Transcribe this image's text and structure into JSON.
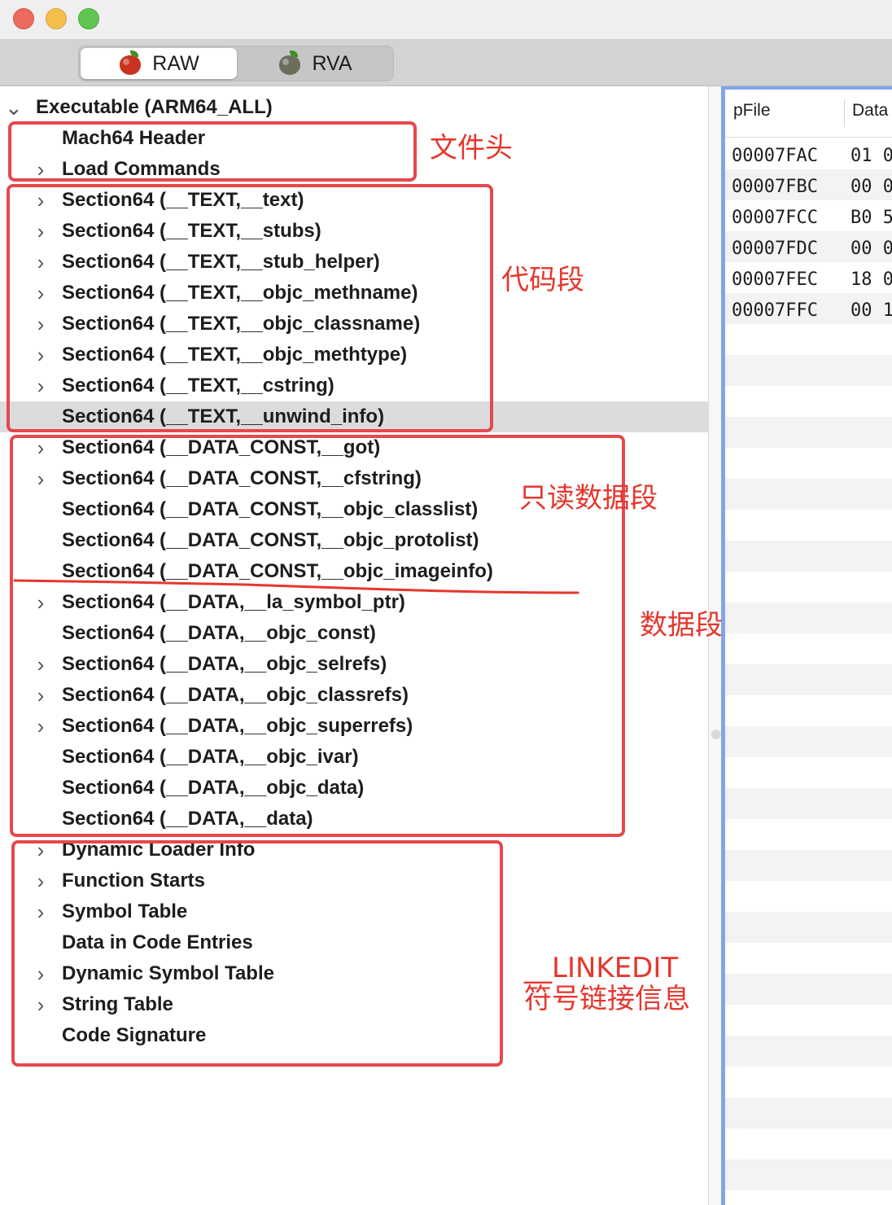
{
  "window": {
    "controls": [
      "close",
      "minimize",
      "zoom"
    ]
  },
  "toolbar": {
    "segments": [
      {
        "label": "RAW",
        "icon": "apple-app-icon",
        "selected": true
      },
      {
        "label": "RVA",
        "icon": "apple-app-icon-gray",
        "selected": false
      }
    ]
  },
  "tree": {
    "root": {
      "label": "Executable  (ARM64_ALL)",
      "expanded": true
    },
    "items": [
      {
        "label": "Mach64 Header",
        "has_children": false
      },
      {
        "label": "Load Commands",
        "has_children": true
      },
      {
        "label": "Section64 (__TEXT,__text)",
        "has_children": true
      },
      {
        "label": "Section64 (__TEXT,__stubs)",
        "has_children": true
      },
      {
        "label": "Section64 (__TEXT,__stub_helper)",
        "has_children": true
      },
      {
        "label": "Section64 (__TEXT,__objc_methname)",
        "has_children": true
      },
      {
        "label": "Section64 (__TEXT,__objc_classname)",
        "has_children": true
      },
      {
        "label": "Section64 (__TEXT,__objc_methtype)",
        "has_children": true
      },
      {
        "label": "Section64 (__TEXT,__cstring)",
        "has_children": true
      },
      {
        "label": "Section64 (__TEXT,__unwind_info)",
        "has_children": false,
        "selected": true
      },
      {
        "label": "Section64 (__DATA_CONST,__got)",
        "has_children": true
      },
      {
        "label": "Section64 (__DATA_CONST,__cfstring)",
        "has_children": true
      },
      {
        "label": "Section64 (__DATA_CONST,__objc_classlist)",
        "has_children": false
      },
      {
        "label": "Section64 (__DATA_CONST,__objc_protolist)",
        "has_children": false
      },
      {
        "label": "Section64 (__DATA_CONST,__objc_imageinfo)",
        "has_children": false
      },
      {
        "label": "Section64 (__DATA,__la_symbol_ptr)",
        "has_children": true
      },
      {
        "label": "Section64 (__DATA,__objc_const)",
        "has_children": false
      },
      {
        "label": "Section64 (__DATA,__objc_selrefs)",
        "has_children": true
      },
      {
        "label": "Section64 (__DATA,__objc_classrefs)",
        "has_children": true
      },
      {
        "label": "Section64 (__DATA,__objc_superrefs)",
        "has_children": true
      },
      {
        "label": "Section64 (__DATA,__objc_ivar)",
        "has_children": false
      },
      {
        "label": "Section64 (__DATA,__objc_data)",
        "has_children": false
      },
      {
        "label": "Section64 (__DATA,__data)",
        "has_children": false
      },
      {
        "label": "Dynamic Loader Info",
        "has_children": true
      },
      {
        "label": "Function Starts",
        "has_children": true
      },
      {
        "label": "Symbol Table",
        "has_children": true
      },
      {
        "label": "Data in Code Entries",
        "has_children": false
      },
      {
        "label": "Dynamic Symbol Table",
        "has_children": true
      },
      {
        "label": "String Table",
        "has_children": true
      },
      {
        "label": "Code Signature",
        "has_children": false
      }
    ]
  },
  "detail": {
    "columns": [
      "pFile",
      "Data"
    ],
    "rows": [
      {
        "offset": "00007FAC",
        "data": "01 0"
      },
      {
        "offset": "00007FBC",
        "data": "00 0"
      },
      {
        "offset": "00007FCC",
        "data": "B0 5"
      },
      {
        "offset": "00007FDC",
        "data": "00 0"
      },
      {
        "offset": "00007FEC",
        "data": "18 0"
      },
      {
        "offset": "00007FFC",
        "data": "00 1"
      }
    ]
  },
  "annotations": {
    "color": "#e5372d",
    "labels": {
      "header": "文件头",
      "code": "代码段",
      "readonly_data": "只读数据段",
      "data": "数据段",
      "linkedit_line1": "__LINKEDIT",
      "linkedit_line2": "符号链接信息"
    }
  }
}
